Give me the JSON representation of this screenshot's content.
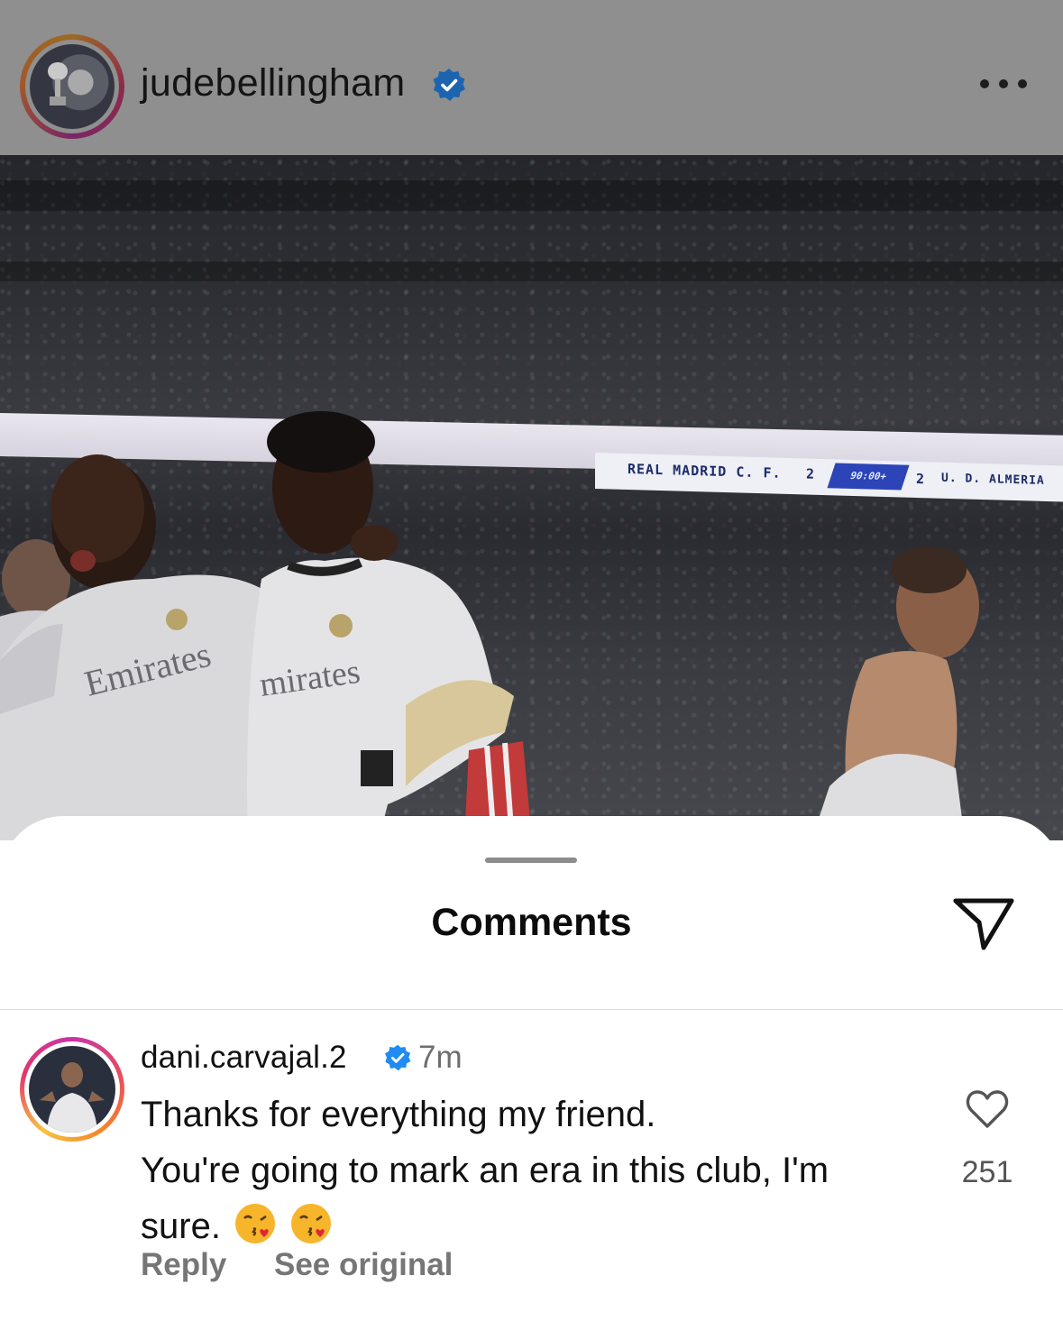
{
  "post": {
    "username": "judebellingham",
    "verified": true,
    "more_icon": "more-horizontal-icon"
  },
  "photo": {
    "scoreboard": {
      "home_team": "REAL MADRID C. F.",
      "home_score": "2",
      "clock": "90:00+",
      "away_score": "2",
      "away_team": "U. D. ALMERIA"
    },
    "jersey_sponsor_left": "Emirates",
    "jersey_sponsor_right": "mirates"
  },
  "comments_sheet": {
    "title": "Comments",
    "share_icon": "send-paper-plane-icon",
    "comment": {
      "username": "dani.carvajal.2",
      "verified": true,
      "time": "7m",
      "text_line1": "Thanks for everything my friend.",
      "text_line2": "You're going to mark an era in this club, I'm sure.",
      "emojis": [
        "face-blowing-kiss",
        "face-blowing-kiss"
      ],
      "like_count": "251",
      "reply_label": "Reply",
      "see_original_label": "See original"
    }
  },
  "colors": {
    "verified_blue": "#1f8bf3",
    "header_dim": "#8f8f8f",
    "secondary_text": "#767676"
  }
}
